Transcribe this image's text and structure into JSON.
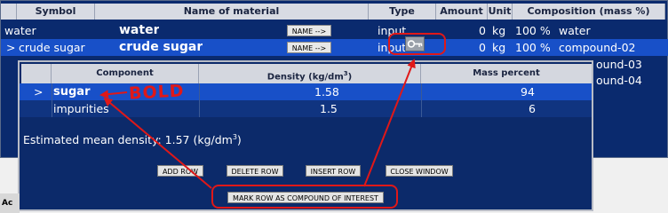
{
  "main": {
    "headers": {
      "symbol": "Symbol",
      "name": "Name of material",
      "type": "Type",
      "amount": "Amount",
      "unit": "Unit",
      "composition": "Composition (mass %)"
    },
    "rows": [
      {
        "marker": "",
        "symbol": "water",
        "name": "water",
        "button": "NAME -->",
        "type": "input",
        "amount": "0",
        "unit": "kg",
        "pct": "100 %",
        "comp": "water"
      },
      {
        "marker": ">",
        "symbol": "crude sugar",
        "name": "crude sugar",
        "button": "NAME -->",
        "type": "input",
        "amount": "0",
        "unit": "kg",
        "pct": "100 %",
        "comp": "compound-02"
      }
    ],
    "hidden_comp": [
      "ound-03",
      "ound-04"
    ]
  },
  "popup": {
    "headers": {
      "component": "Component",
      "density_pre": "Density (kg/dm",
      "density_sup": "3",
      "density_post": ")",
      "mass": "Mass percent"
    },
    "rows": [
      {
        "marker": ">",
        "component": "sugar",
        "density": "1.58",
        "mass": "94"
      },
      {
        "marker": "",
        "component": "impurities",
        "density": "1.5",
        "mass": "6"
      }
    ],
    "density_pre": "Estimated mean density: 1.57 (kg/dm",
    "density_sup": "3",
    "density_post": ")",
    "buttons": {
      "add_row": "ADD ROW",
      "delete_row": "DELETE ROW",
      "insert_row": "INSERT ROW",
      "close_window": "CLOSE WINDOW",
      "mark": "MARK ROW AS COMPOUND OF INTEREST"
    }
  },
  "annotation": {
    "bold_label": "BOLD",
    "color": "#e01818"
  },
  "taskbar": {
    "label": "Ac"
  },
  "icons": {
    "key": "key-icon"
  }
}
